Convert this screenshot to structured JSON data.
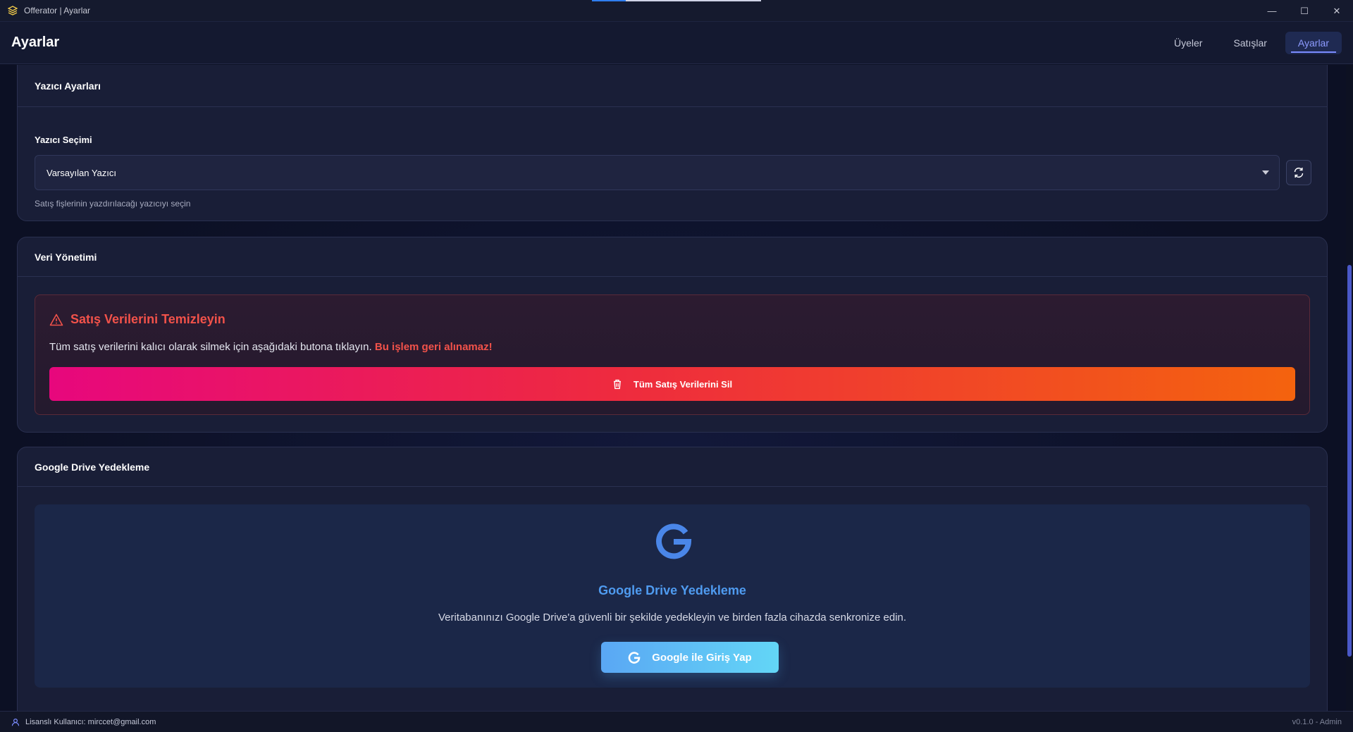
{
  "window": {
    "title": "Offerator | Ayarlar",
    "controls": {
      "minimize": "—",
      "maximize": "☐",
      "close": "✕"
    }
  },
  "header": {
    "title": "Ayarlar",
    "nav": [
      {
        "label": "Üyeler",
        "active": false
      },
      {
        "label": "Satışlar",
        "active": false
      },
      {
        "label": "Ayarlar",
        "active": true
      }
    ]
  },
  "printer_settings": {
    "title": "Yazıcı Ayarları",
    "field_label": "Yazıcı Seçimi",
    "selected_value": "Varsayılan Yazıcı",
    "help": "Satış fişlerinin yazdırılacağı yazıcıyı seçin",
    "refresh_icon": "refresh-icon"
  },
  "data_management": {
    "title": "Veri Yönetimi",
    "danger_title": "Satış Verilerini Temizleyin",
    "danger_desc": "Tüm satış verilerini kalıcı olarak silmek için aşağıdaki butona tıklayın.",
    "danger_warning": "Bu işlem geri alınamaz!",
    "delete_button": "Tüm Satış Verilerini Sil",
    "colors": {
      "danger": "#f2524a",
      "gradient_start": "#e7077d",
      "gradient_end": "#f4630e"
    }
  },
  "google_drive": {
    "card_title": "Google Drive Yedekleme",
    "title": "Google Drive Yedekleme",
    "description": "Veritabanınızı Google Drive'a güvenli bir şekilde yedekleyin ve birden fazla cihazda senkronize edin.",
    "login_button": "Google ile Giriş Yap",
    "colors": {
      "accent": "#4f9bf0"
    }
  },
  "status": {
    "license_user": "Lisanslı Kullanıcı: mirccet@gmail.com",
    "version": "v0.1.0 - Admin"
  }
}
